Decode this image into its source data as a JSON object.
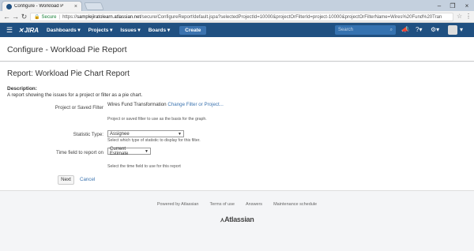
{
  "browser": {
    "tab_title": "Configure - Workload P",
    "tab_close": "×",
    "win_min": "–",
    "win_max": "❐",
    "win_close": "×",
    "back": "←",
    "forward": "→",
    "reload": "↻",
    "lock_icon": "🔒",
    "secure_label": "Secure",
    "url_scheme": "https://",
    "url_host": "samplejiratolearn.atlassian.net",
    "url_path": "/secure/ConfigureReport!default.jspa?selectedProjectId=10000&projectOrFilterId=project-10000&projectOrFilterName=Wires%20Fund%20Tran",
    "star_icon": "☆",
    "menu_icon": "⋮"
  },
  "header": {
    "menu_icon": "☰",
    "logo_mark": "✕",
    "logo_text": "JIRA",
    "nav": [
      "Dashboards ▾",
      "Projects ▾",
      "Issues ▾",
      "Boards ▾"
    ],
    "create_label": "Create",
    "search_placeholder": "Search",
    "search_icon": "⌕",
    "megaphone_icon": "📣",
    "help_icon": "?▾",
    "settings_icon": "⚙▾",
    "avatar_caret": "▾"
  },
  "page": {
    "title": "Configure - Workload Pie Report"
  },
  "report": {
    "title": "Report: Workload Pie Chart Report",
    "description_label": "Description:",
    "description_text": "A report showing the issues for a project or filter as a pie chart.",
    "project_label": "Project or Saved Filter",
    "project_value": "Wires Fund Transformation",
    "project_change_link": "Change Filter or Project...",
    "project_hint": "Project or saved filter to use as the basis for the graph.",
    "statistic_label": "Statistic Type:",
    "statistic_value": "Assignee",
    "statistic_hint": "Select which type of statistic to display for this filter.",
    "time_label": "Time field to report on",
    "time_value": "Current Estimate",
    "time_hint": "Select the time field to use for this report",
    "next_label": "Next",
    "cancel_label": "Cancel"
  },
  "footer": {
    "links": [
      "Powered by Atlassian",
      "Terms of use",
      "Answers",
      "Maintenance schedule"
    ],
    "brand_mark": "⋏",
    "brand": "Atlassian"
  },
  "colors": {
    "header_bg": "#205081",
    "link": "#3b73af",
    "create_btn": "#3b73af"
  }
}
